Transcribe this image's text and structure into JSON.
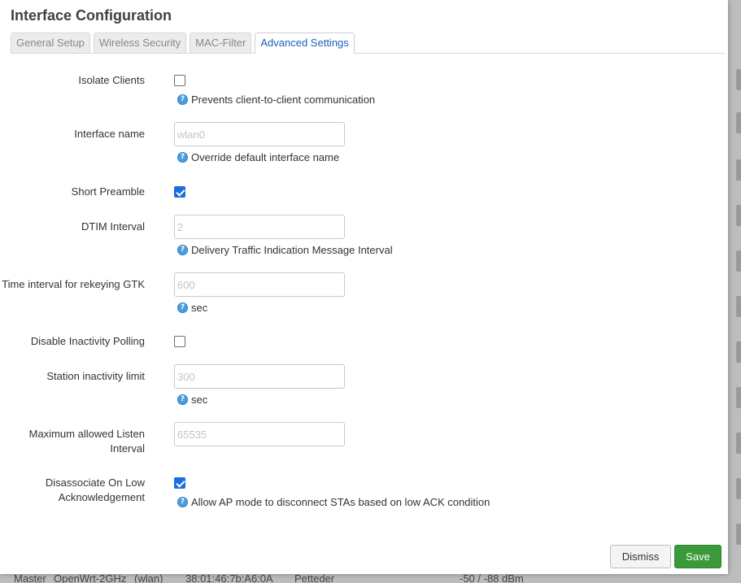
{
  "background": {
    "row_text": [
      "Master",
      "OpenWrt-2GHz",
      "(wlan)",
      "38:01:46:7b:A6:0A",
      "Petteder",
      "-50 / -88 dBm"
    ]
  },
  "modal": {
    "title": "Interface Configuration",
    "tabs": [
      {
        "label": "General Setup",
        "active": false
      },
      {
        "label": "Wireless Security",
        "active": false
      },
      {
        "label": "MAC-Filter",
        "active": false
      },
      {
        "label": "Advanced Settings",
        "active": true
      }
    ],
    "fields": {
      "isolate_clients": {
        "label": "Isolate Clients",
        "checked": false,
        "help": "Prevents client-to-client communication"
      },
      "interface_name": {
        "label": "Interface name",
        "placeholder": "wlan0",
        "help": "Override default interface name"
      },
      "short_preamble": {
        "label": "Short Preamble",
        "checked": true
      },
      "dtim_interval": {
        "label": "DTIM Interval",
        "placeholder": "2",
        "help": "Delivery Traffic Indication Message Interval"
      },
      "rekey_gtk": {
        "label": "Time interval for rekeying GTK",
        "placeholder": "600",
        "help": "sec"
      },
      "disable_inactivity_polling": {
        "label": "Disable Inactivity Polling",
        "checked": false
      },
      "station_inactivity": {
        "label": "Station inactivity limit",
        "placeholder": "300",
        "help": "sec"
      },
      "max_listen_interval": {
        "label_line1": "Maximum allowed Listen",
        "label_line2": "Interval",
        "placeholder": "65535"
      },
      "disassoc_low_ack": {
        "label_line1": "Disassociate On Low",
        "label_line2": "Acknowledgement",
        "checked": true,
        "help": "Allow AP mode to disconnect STAs based on low ACK condition"
      }
    },
    "buttons": {
      "dismiss": "Dismiss",
      "save": "Save"
    }
  },
  "colors": {
    "accent": "#1a6fe0",
    "save": "#3a9a3a",
    "tab_active_text": "#1a5fb4"
  }
}
